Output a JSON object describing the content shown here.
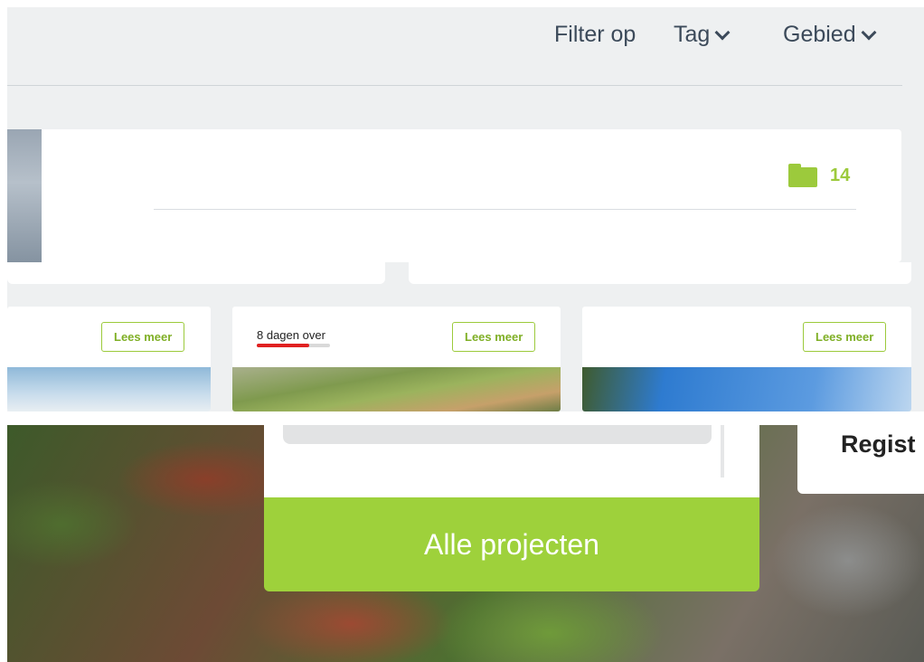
{
  "filter": {
    "label": "Filter op",
    "tag_label": "Tag",
    "area_label": "Gebied"
  },
  "featured": {
    "folder_count": "14"
  },
  "cards": [
    {
      "button": "Lees meer"
    },
    {
      "days_left": "8 dagen over",
      "progress": 0.72,
      "button": "Lees meer"
    },
    {
      "button": "Lees meer"
    }
  ],
  "hero": {
    "all_projects_button": "Alle projecten",
    "register_text": "Regist"
  },
  "colors": {
    "accent": "#9cca3c",
    "progress": "#e02020",
    "background": "#eef0f1"
  }
}
